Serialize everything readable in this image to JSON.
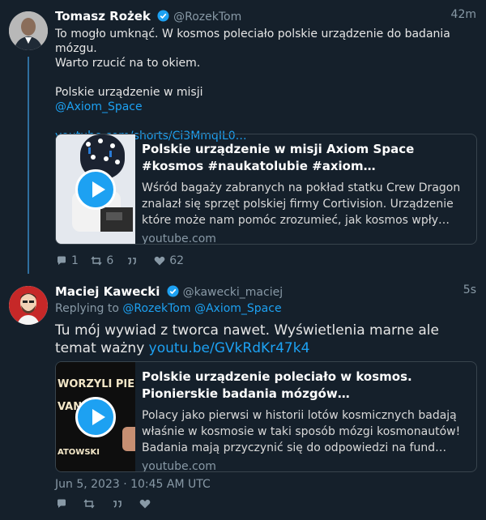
{
  "tweet1": {
    "name": "Tomasz Rożek",
    "handle": "@RozekTom",
    "time": "42m",
    "text_line1": "To mogło umknąć. W kosmos poleciało polskie urządzenie do badania mózgu.",
    "text_line2": "Warto rzucić na to okiem.",
    "text_line3": "Polskie urządzenie w misji",
    "mention": "@Axiom_Space",
    "url": "youtube.com/shorts/Ci3MmqIL0…",
    "card": {
      "title": "Polskie urządzenie w misji Axiom Space #kosmos #naukatolubie #axiom…",
      "description": "Wśród bagaży zabranych na pokład statku Crew Dragon znalazł się sprzęt polskiej firmy Cortivision. Urządzenie które może nam pomóc zrozumieć, jak kosmos wpły…",
      "domain": "youtube.com"
    },
    "actions": {
      "replies": "1",
      "retweets": "6",
      "likes": "62"
    }
  },
  "tweet2": {
    "name": "Maciej Kawecki",
    "handle": "@kawecki_maciej",
    "time": "5s",
    "replying_label": "Replying to",
    "replying_to": "@RozekTom @Axiom_Space",
    "text": "Tu mój wywiad z tworca nawet. Wyświetlenia marne ale temat ważny",
    "link": "youtu.be/GVkRdKr47k4",
    "card": {
      "title": "Polskie urządzenie poleciało w kosmos. Pionierskie badania mózgów…",
      "description": "Polacy jako pierwsi w historii lotów kosmicznych badają właśnie w kosmosie w taki sposób mózgi kosmonautów! Badania mają przyczynić się do odpowiedzi na fund…",
      "domain": "youtube.com",
      "thumb_text_1": "WORZYLI PIERWSZA",
      "thumb_text_2": "VANA",
      "thumb_text_3": "ATOWSKI"
    },
    "date": "Jun 5, 2023 · 10:45 AM UTC"
  },
  "colors": {
    "background": "#15202b",
    "accent": "#1da1f2",
    "thread_line": "#2f6f9f"
  }
}
